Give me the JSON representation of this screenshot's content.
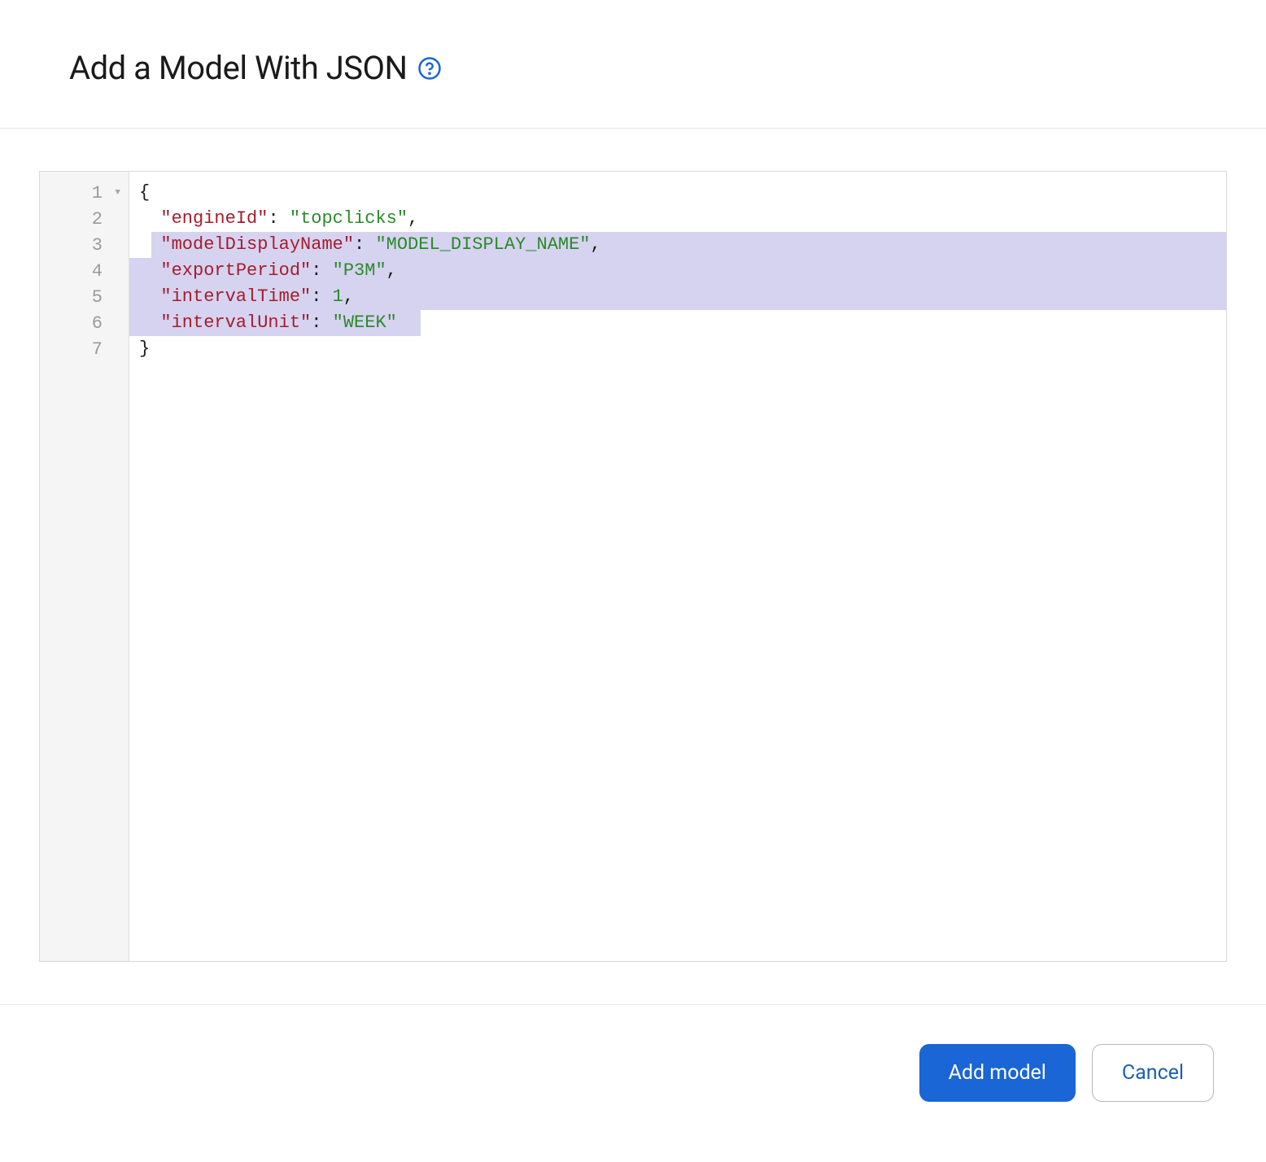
{
  "header": {
    "title": "Add a Model With JSON"
  },
  "editor": {
    "totalLines": 7,
    "foldableLines": [
      1
    ],
    "selectedLines": [
      3,
      4,
      5,
      6
    ],
    "selectionEndChar": 26,
    "lines": [
      {
        "num": 1,
        "indent": 0,
        "tokens": [
          {
            "t": "brace",
            "v": "{"
          }
        ]
      },
      {
        "num": 2,
        "indent": 1,
        "tokens": [
          {
            "t": "key",
            "v": "\"engineId\""
          },
          {
            "t": "colon",
            "v": ": "
          },
          {
            "t": "string",
            "v": "\"topclicks\""
          },
          {
            "t": "comma",
            "v": ","
          }
        ]
      },
      {
        "num": 3,
        "indent": 1,
        "tokens": [
          {
            "t": "key",
            "v": "\"modelDisplayName\""
          },
          {
            "t": "colon",
            "v": ": "
          },
          {
            "t": "string",
            "v": "\"MODEL_DISPLAY_NAME\""
          },
          {
            "t": "comma",
            "v": ","
          }
        ]
      },
      {
        "num": 4,
        "indent": 1,
        "tokens": [
          {
            "t": "key",
            "v": "\"exportPeriod\""
          },
          {
            "t": "colon",
            "v": ": "
          },
          {
            "t": "string",
            "v": "\"P3M\""
          },
          {
            "t": "comma",
            "v": ","
          }
        ]
      },
      {
        "num": 5,
        "indent": 1,
        "tokens": [
          {
            "t": "key",
            "v": "\"intervalTime\""
          },
          {
            "t": "colon",
            "v": ": "
          },
          {
            "t": "num",
            "v": "1"
          },
          {
            "t": "comma",
            "v": ","
          }
        ]
      },
      {
        "num": 6,
        "indent": 1,
        "tokens": [
          {
            "t": "key",
            "v": "\"intervalUnit\""
          },
          {
            "t": "colon",
            "v": ": "
          },
          {
            "t": "string",
            "v": "\"WEEK\""
          }
        ]
      },
      {
        "num": 7,
        "indent": 0,
        "tokens": [
          {
            "t": "brace",
            "v": "}"
          }
        ]
      }
    ]
  },
  "footer": {
    "primary_label": "Add model",
    "secondary_label": "Cancel"
  }
}
